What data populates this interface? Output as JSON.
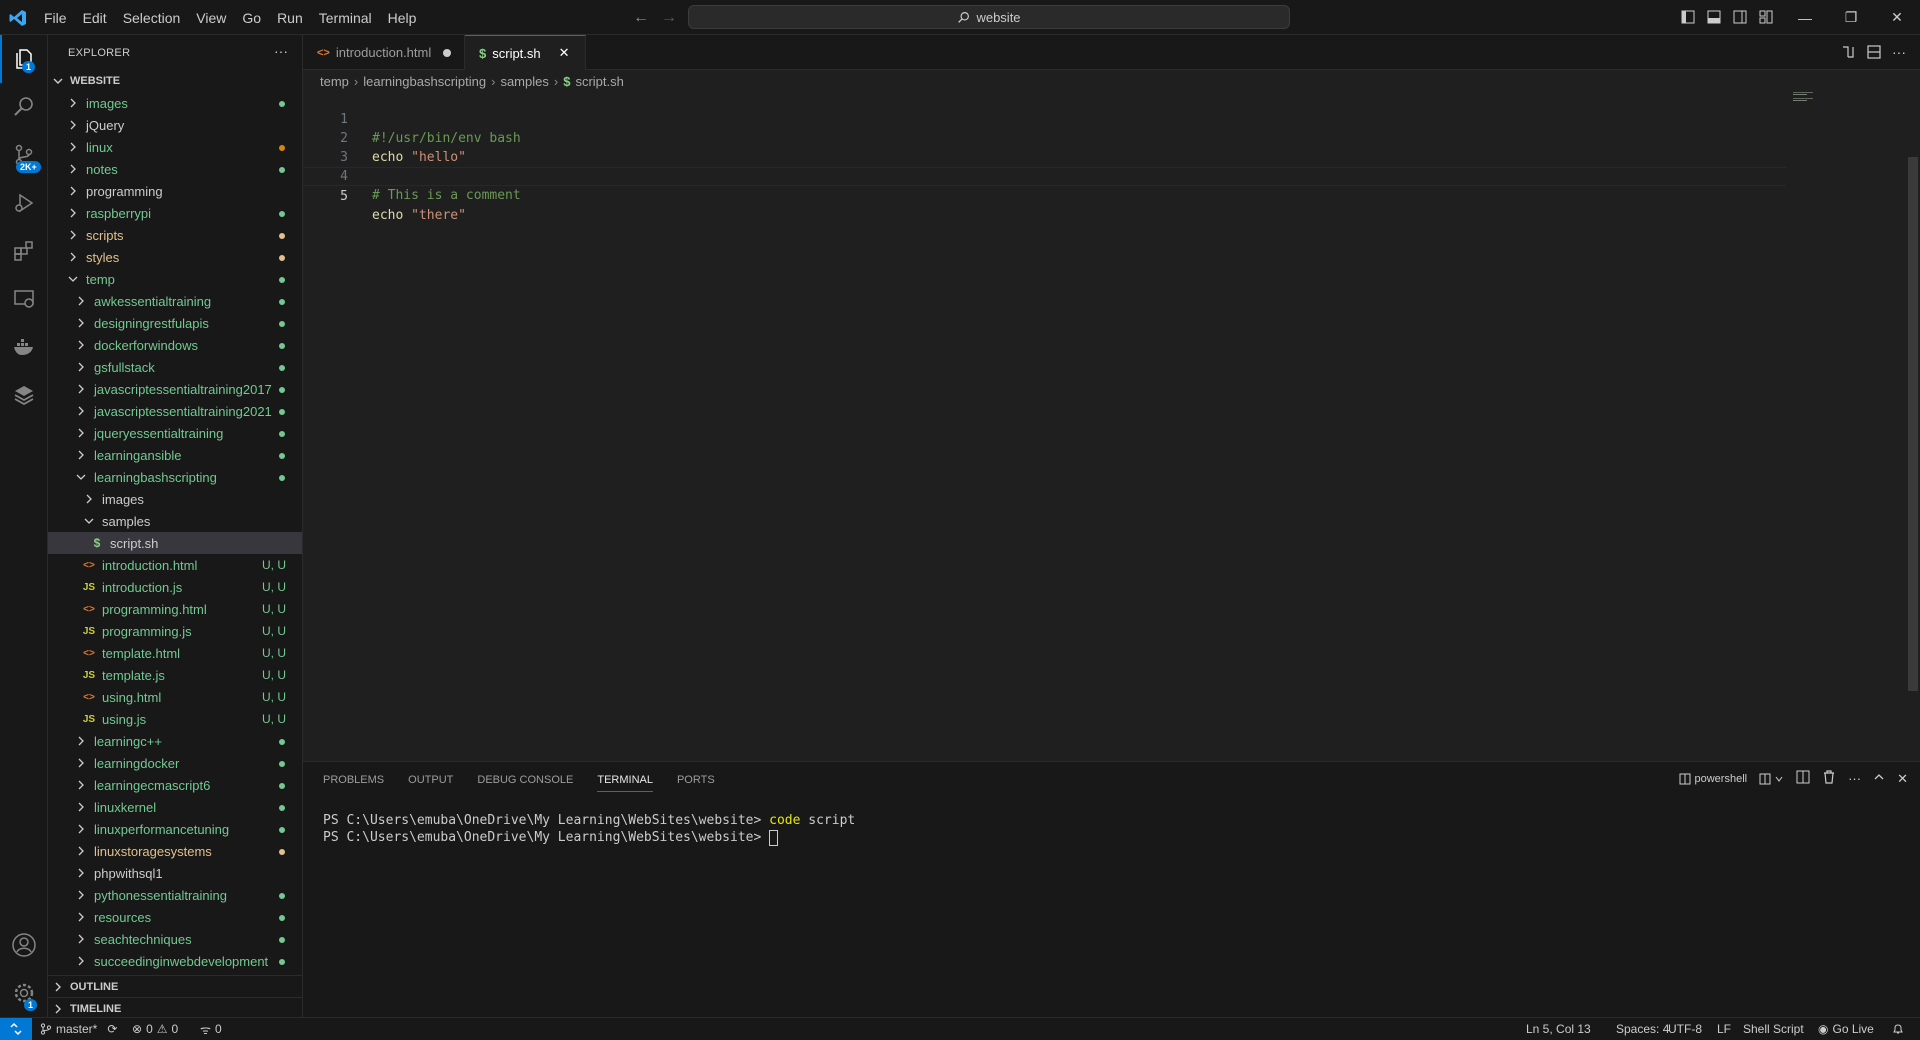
{
  "menu": [
    "File",
    "Edit",
    "Selection",
    "View",
    "Go",
    "Run",
    "Terminal",
    "Help"
  ],
  "search": {
    "label": "website"
  },
  "activity": {
    "explorer_badge": "1",
    "scm_badge": "2K+",
    "settings_badge": "1"
  },
  "explorer": {
    "title": "EXPLORER",
    "more": "···",
    "root": "WEBSITE",
    "items": [
      {
        "label": "images",
        "depth": 0,
        "type": "folder",
        "open": false,
        "color": "#73c991",
        "dot": "#73c991"
      },
      {
        "label": "jQuery",
        "depth": 0,
        "type": "folder",
        "open": false,
        "color": "#cccccc",
        "dot": ""
      },
      {
        "label": "linux",
        "depth": 0,
        "type": "folder",
        "open": false,
        "color": "#73c991",
        "dot": "#d18616"
      },
      {
        "label": "notes",
        "depth": 0,
        "type": "folder",
        "open": false,
        "color": "#73c991",
        "dot": "#73c991"
      },
      {
        "label": "programming",
        "depth": 0,
        "type": "folder",
        "open": false,
        "color": "#cccccc",
        "dot": ""
      },
      {
        "label": "raspberrypi",
        "depth": 0,
        "type": "folder",
        "open": false,
        "color": "#73c991",
        "dot": "#73c991"
      },
      {
        "label": "scripts",
        "depth": 0,
        "type": "folder",
        "open": false,
        "color": "#e2c08d",
        "dot": "#e2c08d"
      },
      {
        "label": "styles",
        "depth": 0,
        "type": "folder",
        "open": false,
        "color": "#e2c08d",
        "dot": "#e2c08d"
      },
      {
        "label": "temp",
        "depth": 0,
        "type": "folder",
        "open": true,
        "color": "#73c991",
        "dot": "#73c991"
      },
      {
        "label": "awkessentialtraining",
        "depth": 1,
        "type": "folder",
        "open": false,
        "color": "#73c991",
        "dot": "#73c991"
      },
      {
        "label": "designingrestfulapis",
        "depth": 1,
        "type": "folder",
        "open": false,
        "color": "#73c991",
        "dot": "#73c991"
      },
      {
        "label": "dockerforwindows",
        "depth": 1,
        "type": "folder",
        "open": false,
        "color": "#73c991",
        "dot": "#73c991"
      },
      {
        "label": "gsfullstack",
        "depth": 1,
        "type": "folder",
        "open": false,
        "color": "#73c991",
        "dot": "#73c991"
      },
      {
        "label": "javascriptessentialtraining2017",
        "depth": 1,
        "type": "folder",
        "open": false,
        "color": "#73c991",
        "dot": "#73c991"
      },
      {
        "label": "javascriptessentialtraining2021",
        "depth": 1,
        "type": "folder",
        "open": false,
        "color": "#73c991",
        "dot": "#73c991"
      },
      {
        "label": "jqueryessentialtraining",
        "depth": 1,
        "type": "folder",
        "open": false,
        "color": "#73c991",
        "dot": "#73c991"
      },
      {
        "label": "learningansible",
        "depth": 1,
        "type": "folder",
        "open": false,
        "color": "#73c991",
        "dot": "#73c991"
      },
      {
        "label": "learningbashscripting",
        "depth": 1,
        "type": "folder",
        "open": true,
        "color": "#73c991",
        "dot": "#73c991"
      },
      {
        "label": "images",
        "depth": 2,
        "type": "folder",
        "open": false,
        "color": "#cccccc",
        "dot": ""
      },
      {
        "label": "samples",
        "depth": 2,
        "type": "folder",
        "open": true,
        "color": "#cccccc",
        "dot": ""
      },
      {
        "label": "script.sh",
        "depth": 3,
        "type": "sh",
        "color": "#cccccc",
        "dot": "",
        "selected": true
      },
      {
        "label": "introduction.html",
        "depth": 2,
        "type": "html",
        "color": "#73c991",
        "status": "U, U"
      },
      {
        "label": "introduction.js",
        "depth": 2,
        "type": "js",
        "color": "#73c991",
        "status": "U, U"
      },
      {
        "label": "programming.html",
        "depth": 2,
        "type": "html",
        "color": "#73c991",
        "status": "U, U"
      },
      {
        "label": "programming.js",
        "depth": 2,
        "type": "js",
        "color": "#73c991",
        "status": "U, U"
      },
      {
        "label": "template.html",
        "depth": 2,
        "type": "html",
        "color": "#73c991",
        "status": "U, U"
      },
      {
        "label": "template.js",
        "depth": 2,
        "type": "js",
        "color": "#73c991",
        "status": "U, U"
      },
      {
        "label": "using.html",
        "depth": 2,
        "type": "html",
        "color": "#73c991",
        "status": "U, U"
      },
      {
        "label": "using.js",
        "depth": 2,
        "type": "js",
        "color": "#73c991",
        "status": "U, U"
      },
      {
        "label": "learningc++",
        "depth": 1,
        "type": "folder",
        "open": false,
        "color": "#73c991",
        "dot": "#73c991"
      },
      {
        "label": "learningdocker",
        "depth": 1,
        "type": "folder",
        "open": false,
        "color": "#73c991",
        "dot": "#73c991"
      },
      {
        "label": "learningecmascript6",
        "depth": 1,
        "type": "folder",
        "open": false,
        "color": "#73c991",
        "dot": "#73c991"
      },
      {
        "label": "linuxkernel",
        "depth": 1,
        "type": "folder",
        "open": false,
        "color": "#73c991",
        "dot": "#73c991"
      },
      {
        "label": "linuxperformancetuning",
        "depth": 1,
        "type": "folder",
        "open": false,
        "color": "#73c991",
        "dot": "#73c991"
      },
      {
        "label": "linuxstoragesystems",
        "depth": 1,
        "type": "folder",
        "open": false,
        "color": "#e2c08d",
        "dot": "#e2c08d"
      },
      {
        "label": "phpwithsql1",
        "depth": 1,
        "type": "folder",
        "open": false,
        "color": "#cccccc",
        "dot": ""
      },
      {
        "label": "pythonessentialtraining",
        "depth": 1,
        "type": "folder",
        "open": false,
        "color": "#73c991",
        "dot": "#73c991"
      },
      {
        "label": "resources",
        "depth": 1,
        "type": "folder",
        "open": false,
        "color": "#73c991",
        "dot": "#73c991"
      },
      {
        "label": "seachtechniques",
        "depth": 1,
        "type": "folder",
        "open": false,
        "color": "#73c991",
        "dot": "#73c991"
      },
      {
        "label": "succeedinginwebdevelopment",
        "depth": 1,
        "type": "folder",
        "open": false,
        "color": "#73c991",
        "dot": "#73c991"
      }
    ],
    "outline": "OUTLINE",
    "timeline": "TIMELINE"
  },
  "tabs": [
    {
      "label": "introduction.html",
      "modified": true,
      "active": false
    },
    {
      "label": "script.sh",
      "modified": false,
      "active": true
    }
  ],
  "breadcrumb": [
    "temp",
    "learningbashscripting",
    "samples",
    "script.sh"
  ],
  "code": [
    {
      "n": "1",
      "text": "#!/usr/bin/env bash",
      "kind": "comment"
    },
    {
      "n": "2",
      "kw": "echo",
      "str": "\"hello\"",
      "kind": "cmd"
    },
    {
      "n": "3",
      "text": "",
      "kind": "blank"
    },
    {
      "n": "4",
      "text": "# This is a comment",
      "kind": "comment"
    },
    {
      "n": "5",
      "kw": "echo",
      "str": "\"there\"",
      "kind": "cmd"
    }
  ],
  "panel": {
    "tabs": [
      "PROBLEMS",
      "OUTPUT",
      "DEBUG CONSOLE",
      "TERMINAL",
      "PORTS"
    ],
    "active_tab": "TERMINAL",
    "shell": "powershell",
    "terminal": {
      "line1_prompt": "PS C:\\Users\\emuba\\OneDrive\\My Learning\\WebSites\\website>",
      "line1_cmd": "code",
      "line1_arg": "script",
      "line2_prompt": "PS C:\\Users\\emuba\\OneDrive\\My Learning\\WebSites\\website>"
    }
  },
  "status": {
    "branch": "master*",
    "errors": "0",
    "warnings": "0",
    "ports": "0",
    "position": "Ln 5, Col 13",
    "spaces": "Spaces: 4",
    "encoding": "UTF-8",
    "eol": "LF",
    "language": "Shell Script",
    "golive": "Go Live"
  },
  "colors": {
    "accent": "#0078d4",
    "untracked": "#73c991",
    "modified": "#e2c08d"
  }
}
